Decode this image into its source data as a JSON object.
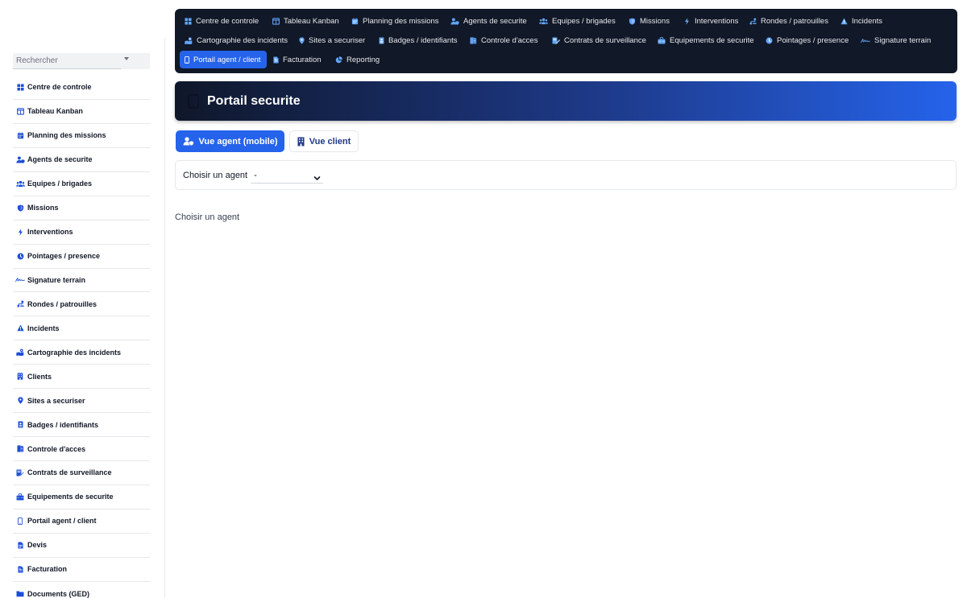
{
  "search": {
    "placeholder": "Rechercher"
  },
  "sidebar": {
    "items": [
      {
        "label": "Centre de controle",
        "icon": "dashboard-icon"
      },
      {
        "label": "Tableau Kanban",
        "icon": "kanban-icon"
      },
      {
        "label": "Planning des missions",
        "icon": "calendar-icon"
      },
      {
        "label": "Agents de securite",
        "icon": "user-shield-icon"
      },
      {
        "label": "Equipes / brigades",
        "icon": "users-icon"
      },
      {
        "label": "Missions",
        "icon": "shield-icon"
      },
      {
        "label": "Interventions",
        "icon": "bolt-icon"
      },
      {
        "label": "Pointages / presence",
        "icon": "clock-icon"
      },
      {
        "label": "Signature terrain",
        "icon": "signature-icon"
      },
      {
        "label": "Rondes / patrouilles",
        "icon": "route-icon"
      },
      {
        "label": "Incidents",
        "icon": "warning-icon"
      },
      {
        "label": "Cartographie des incidents",
        "icon": "map-icon"
      },
      {
        "label": "Clients",
        "icon": "building-icon"
      },
      {
        "label": "Sites a securiser",
        "icon": "location-pin-icon"
      },
      {
        "label": "Badges / identifiants",
        "icon": "badge-icon"
      },
      {
        "label": "Controle d'acces",
        "icon": "door-icon"
      },
      {
        "label": "Contrats de surveillance",
        "icon": "contract-icon"
      },
      {
        "label": "Equipements de securite",
        "icon": "toolbox-icon"
      },
      {
        "label": "Portail agent / client",
        "icon": "mobile-icon"
      },
      {
        "label": "Devis",
        "icon": "file-icon"
      },
      {
        "label": "Facturation",
        "icon": "invoice-icon"
      },
      {
        "label": "Documents (GED)",
        "icon": "folder-icon"
      }
    ]
  },
  "topnav": {
    "items": [
      {
        "label": "Centre de controle",
        "icon": "dashboard-icon",
        "active": false
      },
      {
        "label": "Tableau Kanban",
        "icon": "kanban-icon",
        "active": false
      },
      {
        "label": "Planning des missions",
        "icon": "calendar-icon",
        "active": false
      },
      {
        "label": "Agents de securite",
        "icon": "user-shield-icon",
        "active": false
      },
      {
        "label": "Equipes / brigades",
        "icon": "users-icon",
        "active": false
      },
      {
        "label": "Missions",
        "icon": "shield-icon",
        "active": false
      },
      {
        "label": "Interventions",
        "icon": "bolt-icon",
        "active": false
      },
      {
        "label": "Rondes / patrouilles",
        "icon": "route-icon",
        "active": false
      },
      {
        "label": "Incidents",
        "icon": "warning-icon",
        "active": false
      },
      {
        "label": "Cartographie des incidents",
        "icon": "map-icon",
        "active": false
      },
      {
        "label": "Sites a securiser",
        "icon": "location-pin-icon",
        "active": false
      },
      {
        "label": "Badges / identifiants",
        "icon": "badge-icon",
        "active": false
      },
      {
        "label": "Controle d'acces",
        "icon": "door-icon",
        "active": false
      },
      {
        "label": "Contrats de surveillance",
        "icon": "contract-icon",
        "active": false
      },
      {
        "label": "Equipements de securite",
        "icon": "toolbox-icon",
        "active": false
      },
      {
        "label": "Pointages / presence",
        "icon": "clock-icon",
        "active": false
      },
      {
        "label": "Signature terrain",
        "icon": "signature-icon",
        "active": false
      },
      {
        "label": "Portail agent / client",
        "icon": "mobile-icon",
        "active": true
      },
      {
        "label": "Facturation",
        "icon": "invoice-icon",
        "active": false
      },
      {
        "label": "Reporting",
        "icon": "chart-pie-icon",
        "active": false
      }
    ]
  },
  "header": {
    "title": "Portail securite",
    "icon": "mobile-icon"
  },
  "views": {
    "agent_label": "Vue agent (mobile)",
    "client_label": "Vue client",
    "active": "agent"
  },
  "chooser": {
    "label": "Choisir un agent",
    "selected": "-"
  },
  "empty_message": "Choisir un agent",
  "colors": {
    "accent": "#2563eb",
    "nav_bg": "#111827",
    "icon_blue": "#1d4ed8",
    "nav_icon": "#60a5fa"
  }
}
